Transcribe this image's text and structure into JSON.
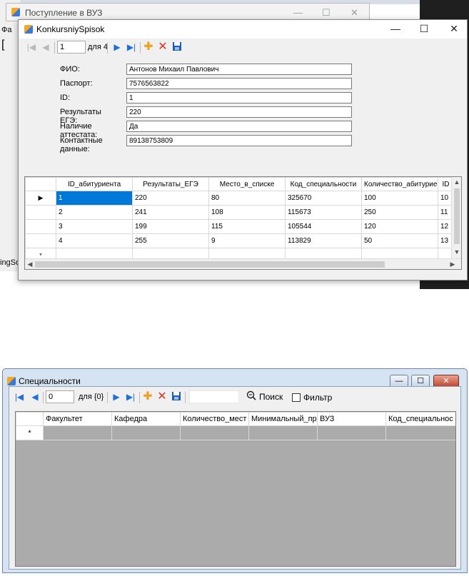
{
  "background": {
    "window_title": "Поступление в ВУЗ",
    "left_fragments": [
      "Фа",
      "[",
      "ingSo"
    ]
  },
  "konkurs": {
    "title": "KonkursniySpisok",
    "nav": {
      "position": "1",
      "of_label": "для 4"
    },
    "form": [
      {
        "label": "ФИО:",
        "value": "Антонов Михаил Павлович"
      },
      {
        "label": "Паспорт:",
        "value": "7576563822"
      },
      {
        "label": "ID:",
        "value": "1"
      },
      {
        "label": "Результаты ЕГЭ:",
        "value": "220"
      },
      {
        "label": "Наличие аттестата:",
        "value": "Да"
      },
      {
        "label": "Контактные данные:",
        "value": "89138753809"
      }
    ],
    "grid": {
      "columns": [
        "ID_абитуриента",
        "Результаты_ЕГЭ",
        "Место_в_списке",
        "Код_специальности",
        "Количество_абитуриен",
        "ID"
      ],
      "rows": [
        [
          "1",
          "220",
          "80",
          "325670",
          "100",
          "10"
        ],
        [
          "2",
          "241",
          "108",
          "115673",
          "250",
          "11"
        ],
        [
          "3",
          "199",
          "115",
          "105544",
          "120",
          "12"
        ],
        [
          "4",
          "255",
          "9",
          "113829",
          "50",
          "13"
        ]
      ],
      "current_marker": "▶",
      "new_marker": "*"
    }
  },
  "spec": {
    "title": "Специальности",
    "nav": {
      "position": "0",
      "of_label": "для {0}"
    },
    "search_label": "Поиск",
    "filter_label": "Фильтр",
    "grid": {
      "columns": [
        "Факультет",
        "Кафедра",
        "Количество_мест",
        "Минимальный_пр",
        "ВУЗ",
        "Код_специальнос"
      ],
      "new_marker": "*"
    }
  },
  "colors": {
    "selection": "#0078d7",
    "grid_empty": "#ababab"
  }
}
